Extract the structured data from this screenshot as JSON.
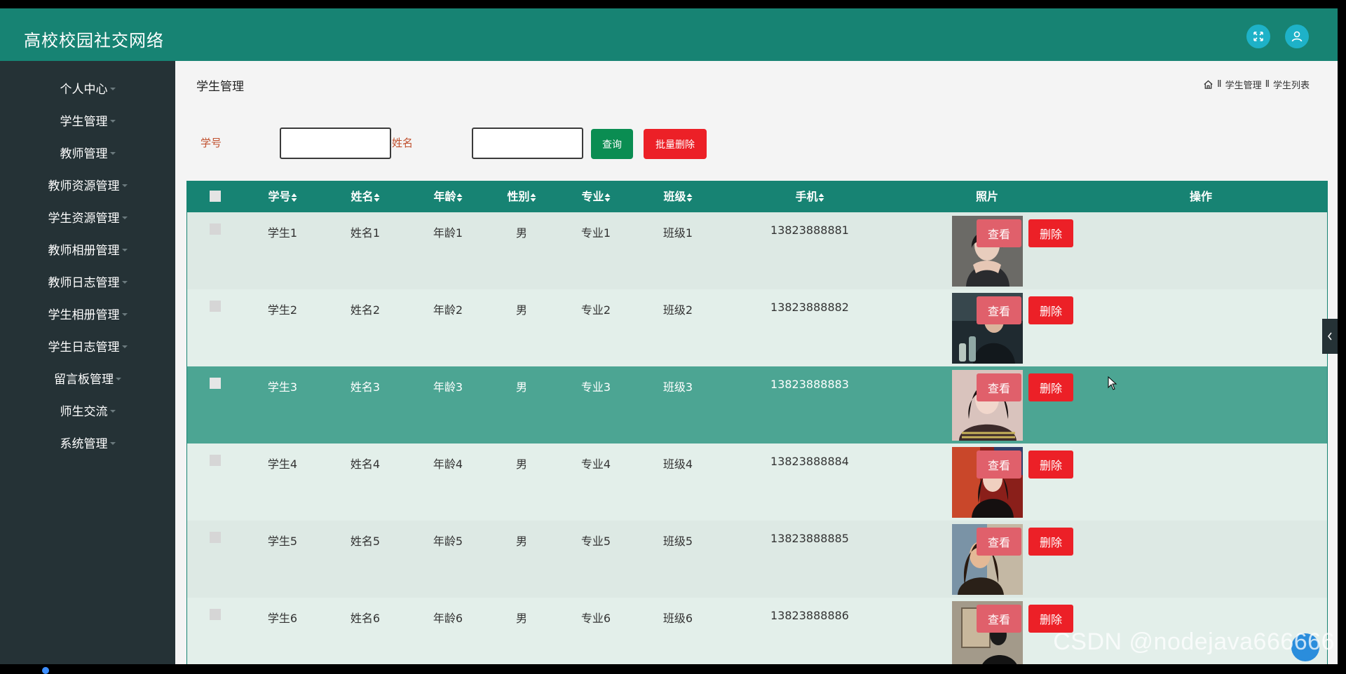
{
  "app": {
    "title": "高校校园社交网络"
  },
  "sidebar": {
    "items": [
      {
        "label": "个人中心"
      },
      {
        "label": "学生管理"
      },
      {
        "label": "教师管理"
      },
      {
        "label": "教师资源管理"
      },
      {
        "label": "学生资源管理"
      },
      {
        "label": "教师相册管理"
      },
      {
        "label": "教师日志管理"
      },
      {
        "label": "学生相册管理"
      },
      {
        "label": "学生日志管理"
      },
      {
        "label": "留言板管理"
      },
      {
        "label": "师生交流"
      },
      {
        "label": "系统管理"
      }
    ]
  },
  "main": {
    "page_title": "学生管理",
    "breadcrumb": {
      "sep": "Ⅱ",
      "section": "学生管理",
      "current": "学生列表"
    },
    "search": {
      "student_id_label": "学号",
      "student_id_value": "",
      "name_label": "姓名",
      "name_value": "",
      "query_button": "查询",
      "batch_delete_button": "批量删除"
    },
    "table": {
      "headers": {
        "student_id": "学号",
        "name": "姓名",
        "age": "年龄",
        "gender": "性别",
        "major": "专业",
        "class": "班级",
        "phone": "手机",
        "photo": "照片",
        "actions": "操作"
      },
      "view_label": "查看",
      "delete_label": "删除",
      "rows": [
        {
          "student_id": "学生1",
          "name": "姓名1",
          "age": "年龄1",
          "gender": "男",
          "major": "专业1",
          "class": "班级1",
          "phone": "13823888881"
        },
        {
          "student_id": "学生2",
          "name": "姓名2",
          "age": "年龄2",
          "gender": "男",
          "major": "专业2",
          "class": "班级2",
          "phone": "13823888882"
        },
        {
          "student_id": "学生3",
          "name": "姓名3",
          "age": "年龄3",
          "gender": "男",
          "major": "专业3",
          "class": "班级3",
          "phone": "13823888883"
        },
        {
          "student_id": "学生4",
          "name": "姓名4",
          "age": "年龄4",
          "gender": "男",
          "major": "专业4",
          "class": "班级4",
          "phone": "13823888884"
        },
        {
          "student_id": "学生5",
          "name": "姓名5",
          "age": "年龄5",
          "gender": "男",
          "major": "专业5",
          "class": "班级5",
          "phone": "13823888885"
        },
        {
          "student_id": "学生6",
          "name": "姓名6",
          "age": "年龄6",
          "gender": "男",
          "major": "专业6",
          "class": "班级6",
          "phone": "13823888886"
        }
      ]
    }
  },
  "watermark": "CSDN @nodejava666666",
  "icons": {
    "fullscreen": "fullscreen-icon",
    "user": "user-icon",
    "home": "home-icon",
    "collapse": "chevron-left-icon"
  },
  "colors": {
    "header": "#178373",
    "sidebar": "#253236",
    "row_even": "#dde9e4",
    "row_odd": "#e3efea",
    "row_hover": "#4ca593",
    "query_button": "#0a8d52",
    "batch_delete_button": "#ec2027",
    "view_button": "#e0606b",
    "delete_button": "#ec2027",
    "label": "#c0502e"
  }
}
